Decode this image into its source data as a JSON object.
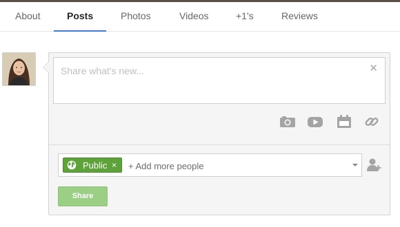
{
  "tabs": [
    {
      "label": "About"
    },
    {
      "label": "Posts",
      "active": true
    },
    {
      "label": "Photos"
    },
    {
      "label": "Videos"
    },
    {
      "label": "+1's"
    },
    {
      "label": "Reviews"
    }
  ],
  "composer": {
    "placeholder": "Share what's new...",
    "close_icon": "close-icon",
    "attachments": [
      "camera-icon",
      "video-icon",
      "calendar-icon",
      "link-icon"
    ]
  },
  "audience": {
    "chip_label": "Public",
    "chip_remove": "×",
    "add_more": "+ Add more people",
    "add_person_icon": "add-person-icon"
  },
  "actions": {
    "share_label": "Share"
  },
  "colors": {
    "accent_tab": "#3f7ad6",
    "chip_green": "#5ea33a",
    "share_button": "#9bcf86"
  }
}
